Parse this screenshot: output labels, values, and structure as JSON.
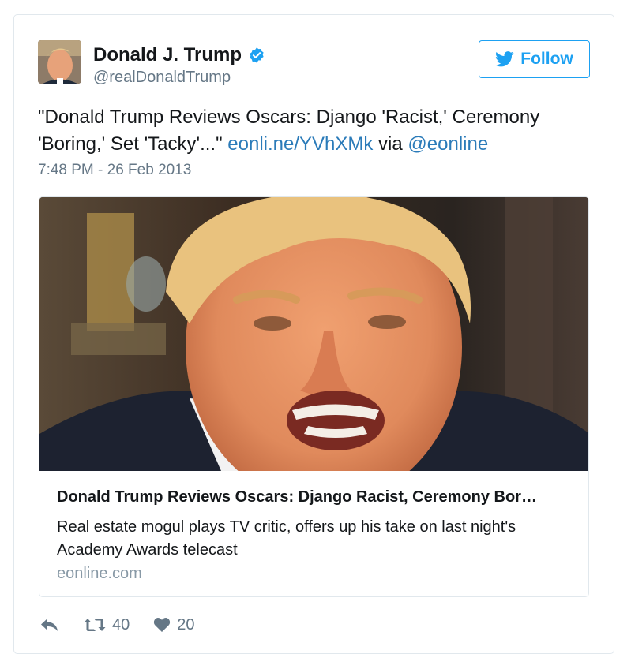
{
  "tweet": {
    "author_name": "Donald J. Trump",
    "author_handle": "@realDonaldTrump",
    "follow_label": "Follow",
    "text_before": "\"Donald Trump Reviews Oscars: Django 'Racist,' Ceremony 'Boring,' Set 'Tacky'...\" ",
    "link_text": "eonli.ne/YVhXMk",
    "text_via": " via ",
    "mention": "@eonline",
    "timestamp": "7:48 PM - 26 Feb 2013",
    "card": {
      "title": "Donald Trump Reviews Oscars: Django Racist, Ceremony Bor…",
      "description": "Real estate mogul plays TV critic, offers up his take on last night's Academy Awards telecast",
      "domain": "eonline.com"
    },
    "actions": {
      "reply_icon": "reply-icon",
      "retweet_icon": "retweet-icon",
      "retweet_count": "40",
      "like_icon": "heart-icon",
      "like_count": "20"
    }
  },
  "colors": {
    "twitter_blue": "#1da1f2",
    "link_blue": "#2b7bb9",
    "gray_text": "#657786",
    "border": "#e1e8ed"
  }
}
